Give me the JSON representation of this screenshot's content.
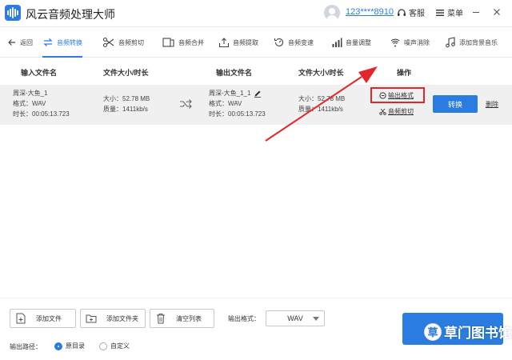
{
  "app": {
    "title": "风云音频处理大师"
  },
  "header": {
    "phone": "123****8910",
    "service_label": "客服",
    "menu_label": "菜单"
  },
  "nav": {
    "back_label": "返回",
    "items": [
      {
        "label": "音频转换"
      },
      {
        "label": "音频剪切"
      },
      {
        "label": "音频合并"
      },
      {
        "label": "音频提取"
      },
      {
        "label": "音频变速"
      },
      {
        "label": "音量调整"
      },
      {
        "label": "噪声消除"
      },
      {
        "label": "添加背景音乐"
      }
    ]
  },
  "table": {
    "headers": {
      "input_name": "输入文件名",
      "input_size": "文件大小/时长",
      "output_name": "输出文件名",
      "output_size": "文件大小/时长",
      "ops": "操作"
    },
    "row": {
      "input": {
        "name": "周深-大鱼_1",
        "format": "格式：WAV",
        "duration": "时长：00:05:13.723"
      },
      "input_size": {
        "size": "大小：52.78 MB",
        "quality": "质量：1411kb/s"
      },
      "output": {
        "name": "周深-大鱼_1_1",
        "format": "格式：WAV",
        "duration": "时长：00:05:13.723"
      },
      "output_size": {
        "size": "大小：52.78 MB",
        "quality": "质量：1411kb/s"
      },
      "ops": {
        "output_format": "输出格式",
        "audio_cut": "音频剪切",
        "convert": "转换",
        "delete": "删除"
      }
    }
  },
  "bottom": {
    "add_file": "添加文件",
    "add_folder": "添加文件夹",
    "clear_list": "清空列表",
    "format_label": "输出格式：",
    "format_value": "WAV",
    "path_label": "输出路径：",
    "path_original": "原目录",
    "path_custom": "自定义"
  },
  "watermark": {
    "icon_text": "草",
    "text": "草门图书馆"
  },
  "colors": {
    "accent": "#2a7ce0",
    "highlight": "#e0282a",
    "row_bg": "#f0f0f0"
  }
}
